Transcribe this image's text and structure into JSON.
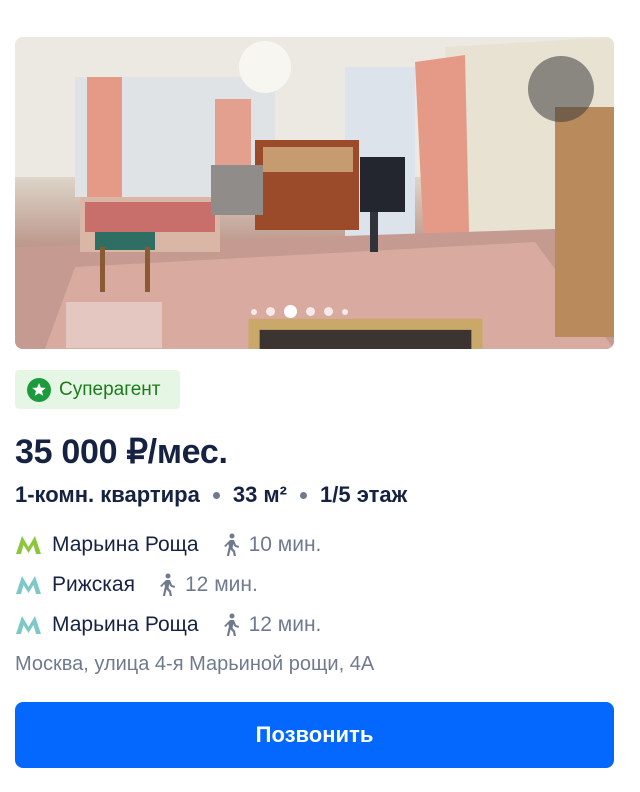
{
  "listing": {
    "badge": {
      "label": "Суперагент",
      "icon": "star-icon",
      "color": "#1d7a1d",
      "background": "#e6f6e4"
    },
    "price": "35 000 ₽/мес.",
    "features": [
      "1-комн. квартира",
      "33 м²",
      "1/5 этаж"
    ],
    "metro": [
      {
        "name": "Марьина Роща",
        "time": "10 мин.",
        "line_color": "#8cc63f"
      },
      {
        "name": "Рижская",
        "time": "12 мин.",
        "line_color": "#7ec8c8"
      },
      {
        "name": "Марьина Роща",
        "time": "12 мин.",
        "line_color": "#7ec8c8"
      }
    ],
    "address": "Москва, улица 4-я Марьиной рощи, 4А",
    "call_button": "Позвонить",
    "photo": {
      "dots_count": 6,
      "active_index": 2,
      "favorite_icon": "heart-icon"
    },
    "colors": {
      "accent": "#0468ff",
      "text": "#152242",
      "secondary_text": "#707a8f"
    }
  }
}
